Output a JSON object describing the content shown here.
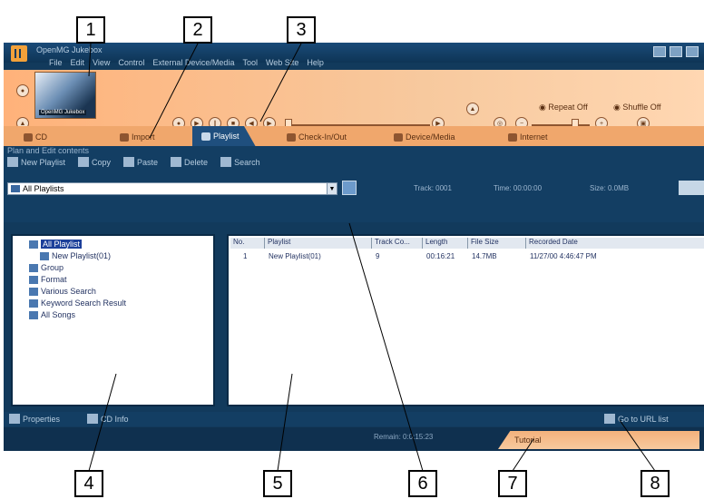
{
  "callouts": [
    "1",
    "2",
    "3",
    "4",
    "5",
    "6",
    "7",
    "8"
  ],
  "app": {
    "title": "OpenMG Jukebox",
    "menu": [
      "File",
      "Edit",
      "View",
      "Control",
      "External Device/Media",
      "Tool",
      "Web Site",
      "Help"
    ]
  },
  "player": {
    "album_label": "OpenMG Jukebox",
    "repeat_label": "Repeat Off",
    "shuffle_label": "Shuffle Off"
  },
  "tabs": [
    {
      "label": "CD"
    },
    {
      "label": "Import"
    },
    {
      "label": "Playlist"
    },
    {
      "label": "Check-In/Out"
    },
    {
      "label": "Device/Media"
    },
    {
      "label": "Internet"
    }
  ],
  "subtoolbar": {
    "caption": "Plan and Edit contents",
    "buttons": [
      "New Playlist",
      "Copy",
      "Paste",
      "Delete",
      "Search"
    ]
  },
  "selector": {
    "value": "All Playlists",
    "track": "Track: 0001",
    "time": "Time: 00:00:00",
    "size": "Size: 0.0MB"
  },
  "tree": [
    {
      "label": "All Playlist",
      "level": 0,
      "selected": true
    },
    {
      "label": "New Playlist(01)",
      "level": 1,
      "selected": false
    },
    {
      "label": "Group",
      "level": 0,
      "selected": false
    },
    {
      "label": "Format",
      "level": 0,
      "selected": false
    },
    {
      "label": "Various Search",
      "level": 0,
      "selected": false
    },
    {
      "label": "Keyword Search Result",
      "level": 0,
      "selected": false
    },
    {
      "label": "All Songs",
      "level": 0,
      "selected": false
    }
  ],
  "list": {
    "columns": [
      "No.",
      "Playlist",
      "Track Co...",
      "Length",
      "File Size",
      "Recorded Date"
    ],
    "rows": [
      [
        "1",
        "New Playlist(01)",
        "9",
        "00:16:21",
        "14.7MB",
        "11/27/00 4:46:47 PM"
      ]
    ]
  },
  "bottom": {
    "properties": "Properties",
    "cd_info": "CD Info",
    "url": "Go to URL list"
  },
  "status": {
    "remaining": "Remain: 0:0:15:23",
    "tutorial": "Tutorial"
  }
}
